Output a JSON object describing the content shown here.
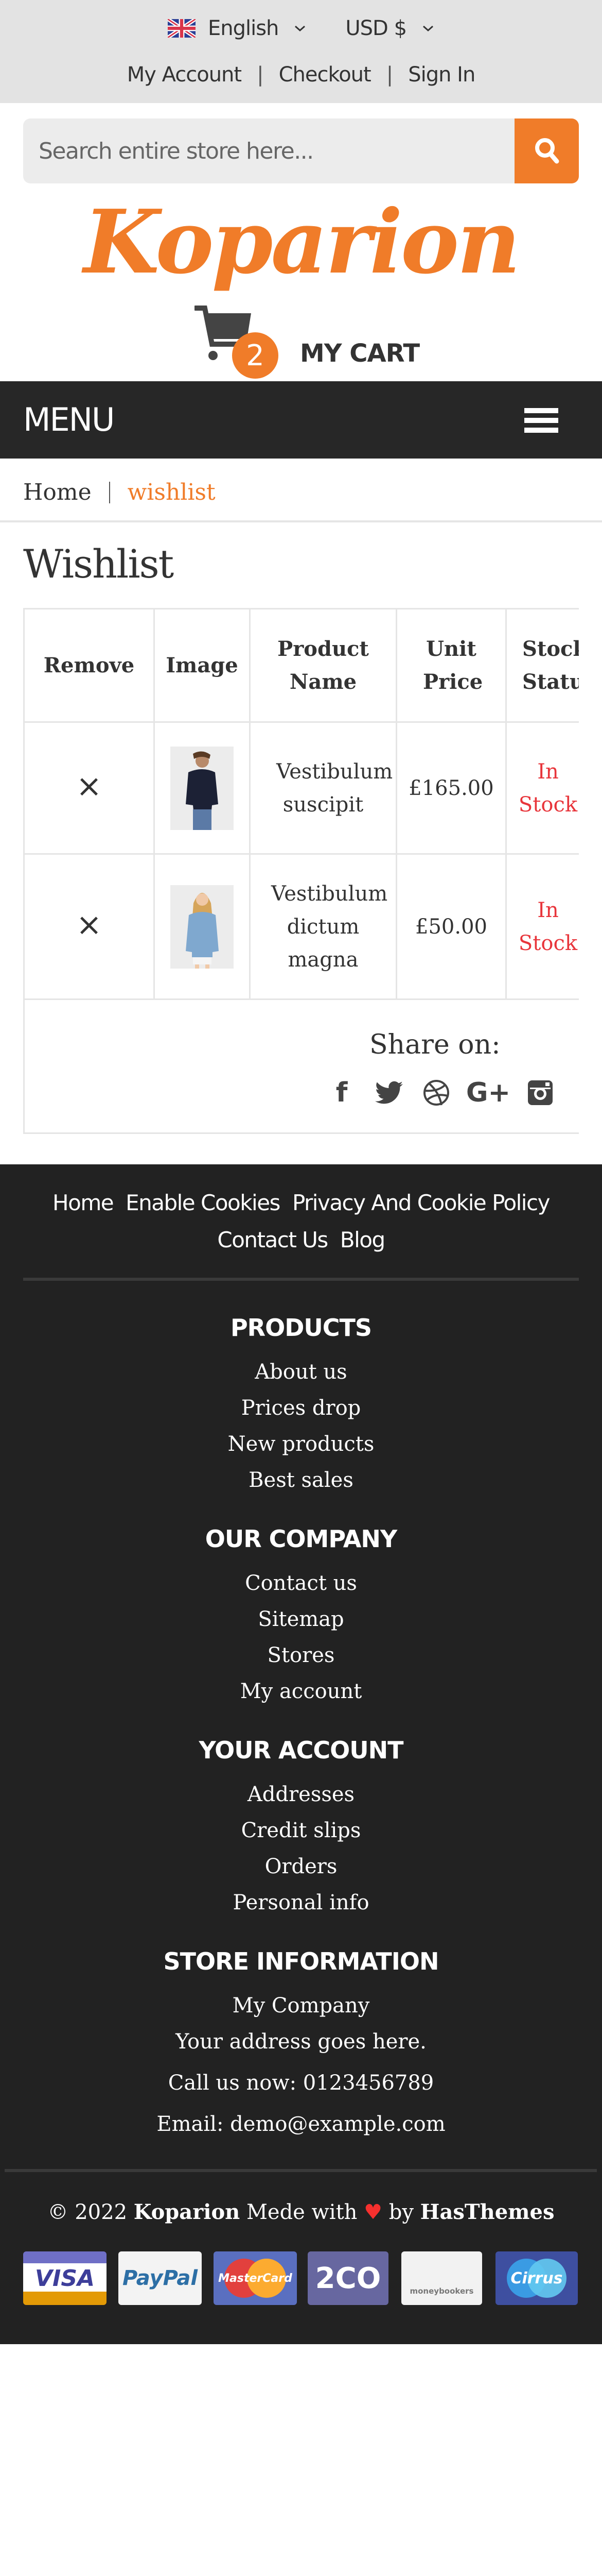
{
  "topbar": {
    "language": "English",
    "currency": "USD $",
    "links": [
      "My Account",
      "Checkout",
      "Sign In"
    ]
  },
  "search": {
    "placeholder": "Search entire store here..."
  },
  "logo": "Koparion",
  "cart": {
    "count": "2",
    "label": "MY CART"
  },
  "menu": {
    "label": "MENU"
  },
  "breadcrumb": {
    "home": "Home",
    "current": "wishlist"
  },
  "page_title": "Wishlist",
  "wishlist_table": {
    "headers": [
      "Remove",
      "Image",
      "Product Name",
      "Unit Price",
      "Stock Status"
    ],
    "rows": [
      {
        "remove": "×",
        "name": "Vestibulum suscipit",
        "price": "£165.00",
        "stock": "In Stock"
      },
      {
        "remove": "×",
        "name": "Vestibulum dictum magna",
        "price": "£50.00",
        "stock": "In Stock"
      }
    ],
    "share_label": "Share on:",
    "share_icons": [
      "facebook-icon",
      "twitter-icon",
      "dribbble-icon",
      "google-plus-icon",
      "instagram-icon"
    ]
  },
  "footer": {
    "links": [
      "Home",
      "Enable Cookies",
      "Privacy And Cookie Policy",
      "Contact Us",
      "Blog"
    ],
    "sections": [
      {
        "title": "PRODUCTS",
        "items": [
          "About us",
          "Prices drop",
          "New products",
          "Best sales"
        ]
      },
      {
        "title": "OUR COMPANY",
        "items": [
          "Contact us",
          "Sitemap",
          "Stores",
          "My account"
        ]
      },
      {
        "title": "YOUR ACCOUNT",
        "items": [
          "Addresses",
          "Credit slips",
          "Orders",
          "Personal info"
        ]
      },
      {
        "title": "STORE INFORMATION",
        "items": [
          "My Company",
          "Your address goes here.",
          "Call us now: 0123456789",
          "Email: demo@example.com"
        ]
      }
    ],
    "copyright": {
      "prefix": "© 2022",
      "brand": "Koparion",
      "middle": "Mede with",
      "by": "by",
      "author": "HasThemes"
    },
    "payments": [
      "VISA",
      "PayPal",
      "MasterCard",
      "2CO",
      "moneybookers",
      "Cirrus"
    ]
  },
  "colors": {
    "accent": "#f07c29",
    "dark": "#222222",
    "stock": "#e8353b",
    "topbar": "#e3e3e3"
  }
}
